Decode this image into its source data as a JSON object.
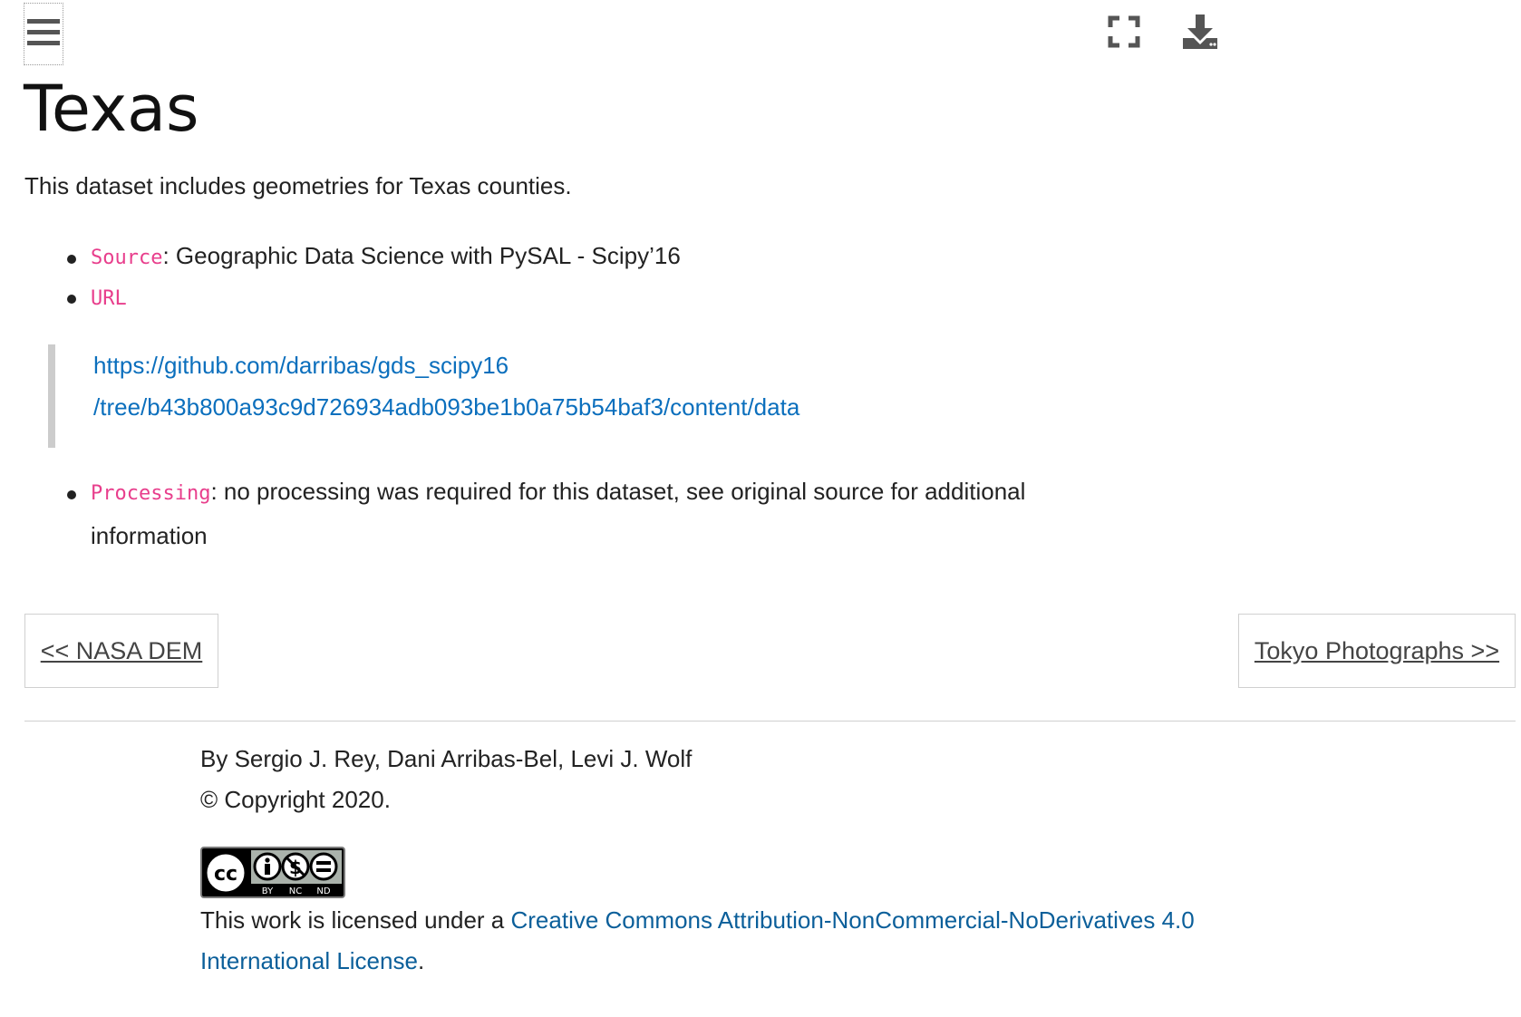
{
  "header": {
    "menu_icon": "hamburger-menu-icon",
    "fullscreen_icon": "fullscreen-icon",
    "download_icon": "download-icon"
  },
  "page": {
    "title": "Texas",
    "intro": "This dataset includes geometries for Texas counties.",
    "items": [
      {
        "key": "Source",
        "text": ": Geographic Data Science with PySAL - Scipy’16"
      },
      {
        "key": "URL",
        "text": ""
      },
      {
        "key": "Processing",
        "text_line1": ": no processing was required for this dataset, see original source for additional",
        "text_line2": "information"
      }
    ],
    "url_line1": "https://github.com/darribas/gds_scipy16",
    "url_line2": "/tree/b43b800a93c9d726934adb093be1b0a75b54baf3/content/data"
  },
  "nav": {
    "prev_label": "<< NASA DEM",
    "next_label": "Tokyo Photographs >>"
  },
  "footer": {
    "authors": "By Sergio J. Rey, Dani Arribas-Bel, Levi J. Wolf",
    "copyright": "© Copyright 2020.",
    "badge": {
      "cc": "cc",
      "labels": [
        "BY",
        "NC",
        "ND"
      ]
    },
    "license_prefix": "This work is licensed under a ",
    "license_link_line1": "Creative Commons Attribution-NonCommercial-NoDerivatives 4.0",
    "license_link_line2": "International License",
    "license_suffix": "."
  },
  "colors": {
    "code": "#e83e8c",
    "link": "#0b6fbd",
    "icon": "#555555"
  }
}
